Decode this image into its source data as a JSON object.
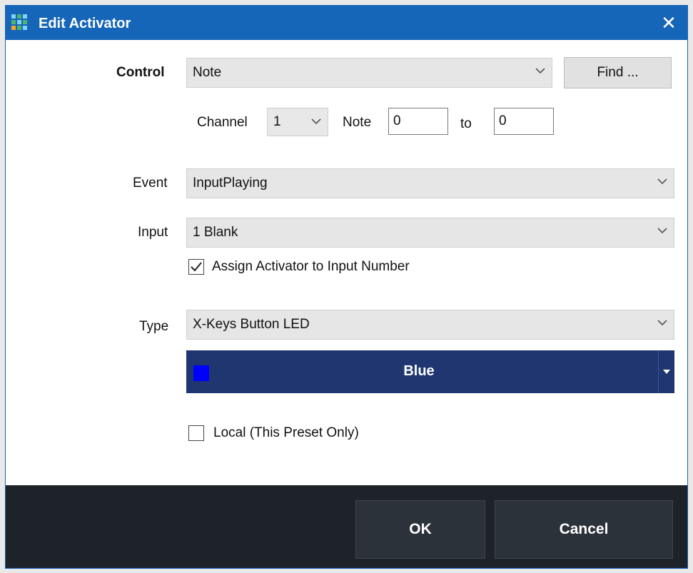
{
  "window": {
    "title": "Edit Activator",
    "close_glyph": "✕"
  },
  "control": {
    "label": "Control",
    "value": "Note",
    "find_label": "Find ..."
  },
  "channel": {
    "label": "Channel",
    "value": "1"
  },
  "note": {
    "label": "Note",
    "from": "0",
    "to_label": "to",
    "to": "0"
  },
  "event": {
    "label": "Event",
    "value": "InputPlaying"
  },
  "input": {
    "label": "Input",
    "value": "1 Blank",
    "assign_label": "Assign Activator to Input Number",
    "assign_checked": true
  },
  "type": {
    "label": "Type",
    "value": "X-Keys Button LED"
  },
  "color": {
    "name": "Blue",
    "swatch": "#0000ff"
  },
  "local": {
    "label": "Local (This Preset Only)",
    "checked": false
  },
  "footer": {
    "ok_label": "OK",
    "cancel_label": "Cancel"
  }
}
